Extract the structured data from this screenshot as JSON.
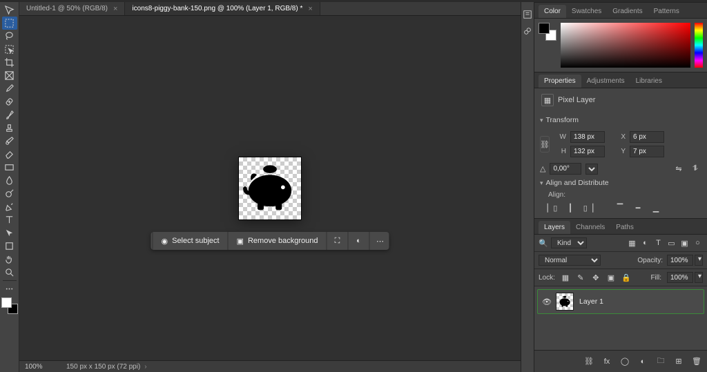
{
  "document_tabs": [
    {
      "title": "Untitled-1 @ 50% (RGB/8)",
      "active": false
    },
    {
      "title": "icons8-piggy-bank-150.png @ 100% (Layer 1, RGB/8) *",
      "active": true
    }
  ],
  "action_bar": {
    "select_subject": "Select subject",
    "remove_background": "Remove background"
  },
  "status": {
    "zoom": "100%",
    "doc_dims": "150 px x 150 px (72 ppi)"
  },
  "color_panel": {
    "tabs": [
      "Color",
      "Swatches",
      "Gradients",
      "Patterns"
    ],
    "active_tab": "Color"
  },
  "properties_panel": {
    "tabs": [
      "Properties",
      "Adjustments",
      "Libraries"
    ],
    "active_tab": "Properties",
    "layer_type": "Pixel Layer",
    "transform": {
      "heading": "Transform",
      "W": "138 px",
      "H": "132 px",
      "X": "6 px",
      "Y": "7 px",
      "angle": "0,00°"
    },
    "align": {
      "heading": "Align and Distribute",
      "sub": "Align:"
    }
  },
  "layers_panel": {
    "tabs": [
      "Layers",
      "Channels",
      "Paths"
    ],
    "active_tab": "Layers",
    "filter_kind": "Kind",
    "blend_mode": "Normal",
    "opacity_label": "Opacity:",
    "opacity_value": "100%",
    "lock_label": "Lock:",
    "fill_label": "Fill:",
    "fill_value": "100%",
    "layers": [
      {
        "name": "Layer 1",
        "visible": true
      }
    ]
  }
}
